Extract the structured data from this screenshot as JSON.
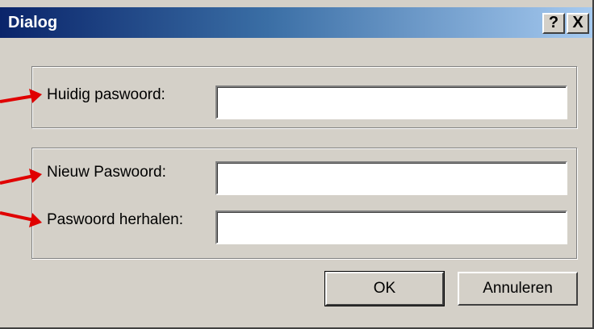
{
  "dialog": {
    "title": "Dialog",
    "help_button": "?",
    "close_button": "X"
  },
  "current_password": {
    "label": "Huidig paswoord:",
    "value": ""
  },
  "new_password": {
    "label": "Nieuw Paswoord:",
    "value": ""
  },
  "repeat_password": {
    "label": "Paswoord herhalen:",
    "value": ""
  },
  "buttons": {
    "ok": "OK",
    "cancel": "Annuleren"
  },
  "colors": {
    "annotation_arrow": "#e00000",
    "titlebar_start": "#0a246a",
    "titlebar_end": "#a6caf0",
    "dialog_face": "#d4d0c8"
  }
}
